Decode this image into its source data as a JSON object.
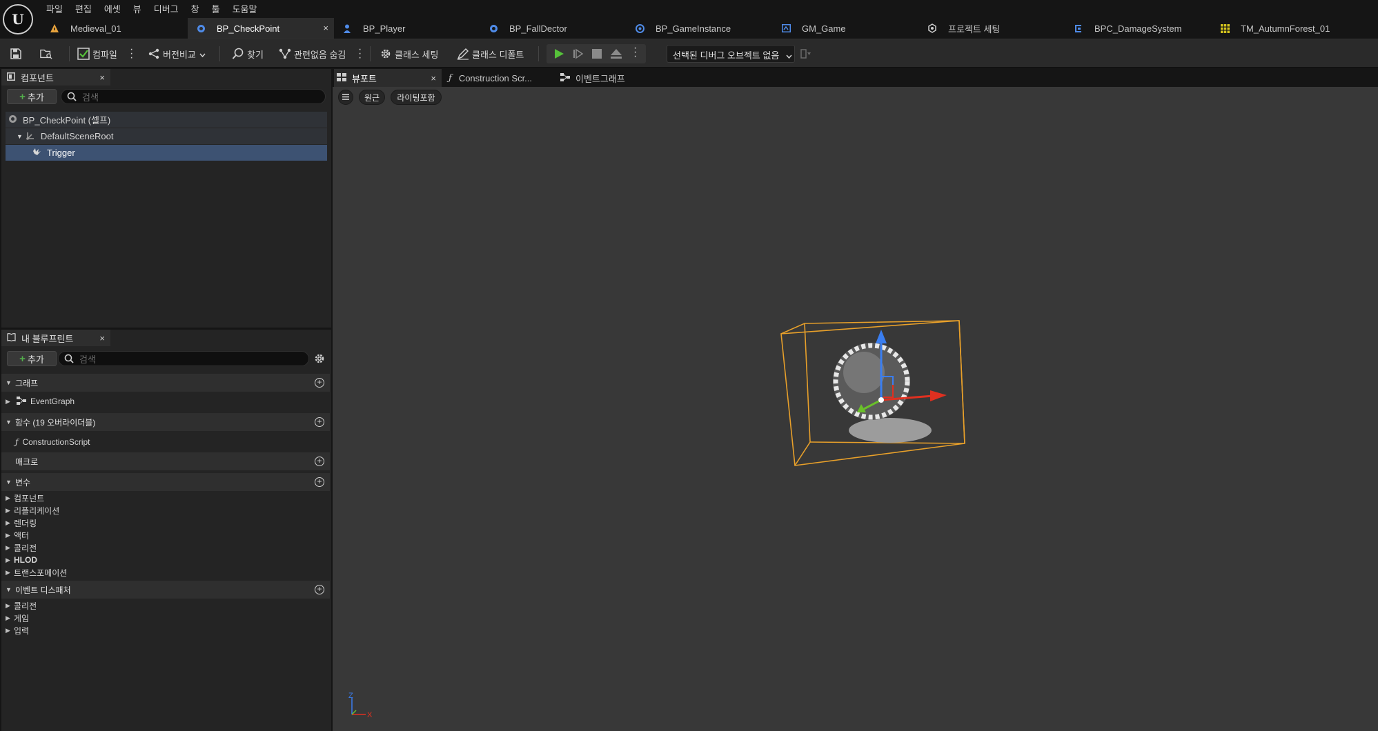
{
  "menu": [
    "파일",
    "편집",
    "에셋",
    "뷰",
    "디버그",
    "창",
    "툴",
    "도움말"
  ],
  "doc_tabs": [
    {
      "label": "Medieval_01",
      "icon": "level-icon",
      "color": "#e8a33c"
    },
    {
      "label": "BP_CheckPoint",
      "icon": "blueprint-actor-icon",
      "color": "#4f8be8",
      "active": true,
      "close": "×"
    },
    {
      "label": "BP_Player",
      "icon": "blueprint-pawn-icon",
      "color": "#4f8be8"
    },
    {
      "label": "BP_FallDector",
      "icon": "blueprint-actor-icon",
      "color": "#4f8be8"
    },
    {
      "label": "BP_GameInstance",
      "icon": "game-instance-icon",
      "color": "#4f8be8"
    },
    {
      "label": "GM_Game",
      "icon": "game-mode-icon",
      "color": "#4f8be8"
    },
    {
      "label": "프로젝트 세팅",
      "icon": "settings-icon",
      "color": "#cfcfcf"
    },
    {
      "label": "BPC_DamageSystem",
      "icon": "component-icon",
      "color": "#4f8be8"
    },
    {
      "label": "TM_AutumnForest_01",
      "icon": "grid-icon",
      "color": "#d4c41e"
    }
  ],
  "toolbar": {
    "compile": "컴파일",
    "diff": "버전비교",
    "find": "찾기",
    "hide_unrelated": "관련없음 숨김",
    "class_settings": "클래스 세팅",
    "class_defaults": "클래스 디폴트",
    "debug_object": "선택된 디버그 오브젝트 없음",
    "accent_play": "#56c23a"
  },
  "components": {
    "title": "컴포넌트",
    "close": "×",
    "add": "추가",
    "plus": "+",
    "search_placeholder": "검색",
    "tree": [
      {
        "label": "BP_CheckPoint (셀프)"
      },
      {
        "label": "DefaultSceneRoot"
      },
      {
        "label": "Trigger"
      }
    ]
  },
  "my_blueprint": {
    "title": "내 블루프린트",
    "close": "×",
    "add": "추가",
    "plus": "+",
    "search_placeholder": "검색",
    "graphs": {
      "label": "그래프",
      "items": [
        "EventGraph"
      ]
    },
    "functions": {
      "label": "함수 (19 오버라이더블)",
      "items": [
        "ConstructionScript"
      ]
    },
    "macros": {
      "label": "매크로"
    },
    "variables": {
      "label": "변수",
      "items": [
        "컴포넌트",
        "리플리케이션",
        "렌더링",
        "액터",
        "콜리전",
        "HLOD",
        "트랜스포메이션"
      ]
    },
    "dispatchers": {
      "label": "이벤트 디스패처",
      "items": [
        "콜리전",
        "게임",
        "입력"
      ]
    }
  },
  "viewport_tabs": [
    {
      "label": "뷰포트",
      "active": true,
      "close": "×"
    },
    {
      "label": "Construction Scr..."
    },
    {
      "label": "이벤트그래프"
    }
  ],
  "viewport": {
    "perspective": "원근",
    "lighting": "라이팅포함",
    "axis_z": "Z",
    "axis_x": "X",
    "bounds_color": "#e8a02a"
  }
}
